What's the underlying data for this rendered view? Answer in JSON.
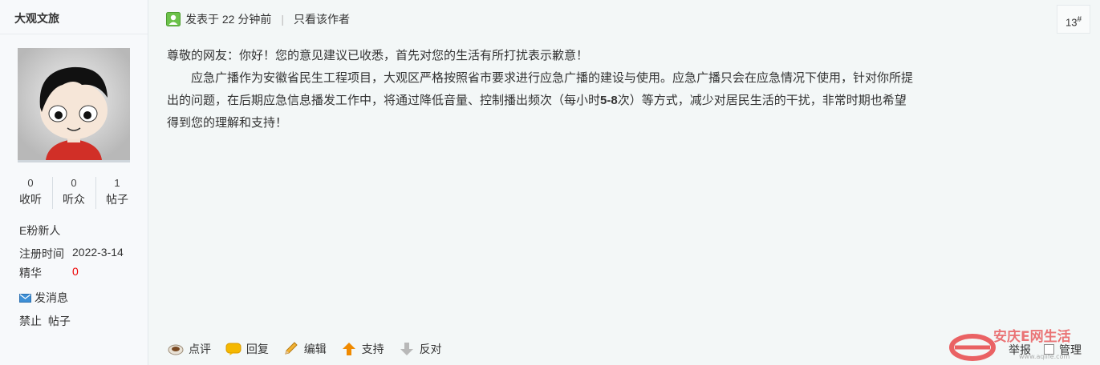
{
  "author": {
    "name": "大观文旅",
    "stats": [
      {
        "value": "0",
        "label": "收听"
      },
      {
        "value": "0",
        "label": "听众"
      },
      {
        "value": "1",
        "label": "帖子"
      }
    ],
    "group": "E粉新人",
    "register_label": "注册时间",
    "register_date": "2022-3-14",
    "digest_label": "精华",
    "digest_value": "0",
    "message_link": "发消息",
    "ban_label": "禁止",
    "posts_label": "帖子"
  },
  "post": {
    "posted_time": "发表于 22 分钟前",
    "divider": "|",
    "only_author": "只看该作者",
    "floor": "13",
    "floor_sup": "#",
    "paragraph1": "尊敬的网友：你好！您的意见建议已收悉，首先对您的生活有所打扰表示歉意！",
    "paragraph2_a": "应急广播作为安徽省民生工程项目，大观区严格按照省市要求进行应急广播的建设与使用。应急广播只会在应急情况下使用，针对你所提出的问题，在后期应急信息播发工作中，将通过降低音量、控制播出频次（每小时",
    "paragraph2_bold": "5-8",
    "paragraph2_b": "次）等方式，减少对居民生活的干扰，非常时期也希望得到您的理解和支持！"
  },
  "actions": {
    "comment": "点评",
    "reply": "回复",
    "edit": "编辑",
    "support": "支持",
    "oppose": "反对",
    "report": "举报",
    "manage": "管理"
  },
  "watermark": {
    "text": "安庆E网生活",
    "url_text": "www.aqlife.com"
  },
  "colors": {
    "sidebar_bg": "#f7f9fb",
    "post_bg": "#f3f7f7",
    "digest_red": "#ee0000",
    "support_orange": "#f08a00",
    "watermark_red": "#e8484a"
  }
}
